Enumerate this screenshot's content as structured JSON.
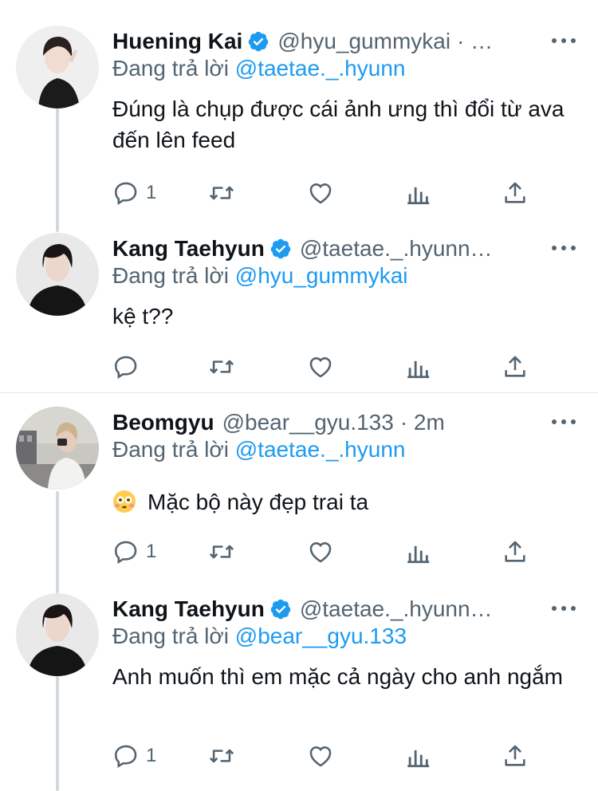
{
  "tweets": [
    {
      "name": "Huening Kai",
      "handle": "@hyu_gummykai",
      "meta": "· …",
      "replying_label": "Đang trả lời",
      "replying_to": "@taetae._.hyunn",
      "text": "Đúng là chụp được cái ảnh ưng thì đổi từ ava đến lên feed",
      "reply_count": "1"
    },
    {
      "name": "Kang Taehyun",
      "handle": "@taetae._.hyunn…",
      "replying_label": "Đang trả lời",
      "replying_to": "@hyu_gummykai",
      "text": "kệ t??",
      "reply_count": ""
    },
    {
      "name": "Beomgyu",
      "handle": "@bear__gyu.133",
      "meta": "· 2m",
      "replying_label": "Đang trả lời",
      "replying_to": "@taetae._.hyunn",
      "text": "Mặc bộ này đẹp trai ta",
      "reply_count": "1"
    },
    {
      "name": "Kang Taehyun",
      "handle": "@taetae._.hyunn…",
      "replying_label": "Đang trả lời",
      "replying_to": "@bear__gyu.133",
      "text": "Anh muốn thì em mặc cả ngày cho anh ngắm",
      "reply_count": "1"
    }
  ],
  "icons": {
    "verified": "verified-badge-icon",
    "reply": "reply-icon",
    "retweet": "retweet-icon",
    "like": "like-icon",
    "analytics": "analytics-icon",
    "share": "share-icon",
    "more": "more-icon",
    "emoji": "flushed-face-emoji"
  },
  "colors": {
    "link": "#1d9bf0",
    "secondary_text": "#536471",
    "thread_line": "#cfd9de",
    "verified": "#1d9bf0"
  }
}
